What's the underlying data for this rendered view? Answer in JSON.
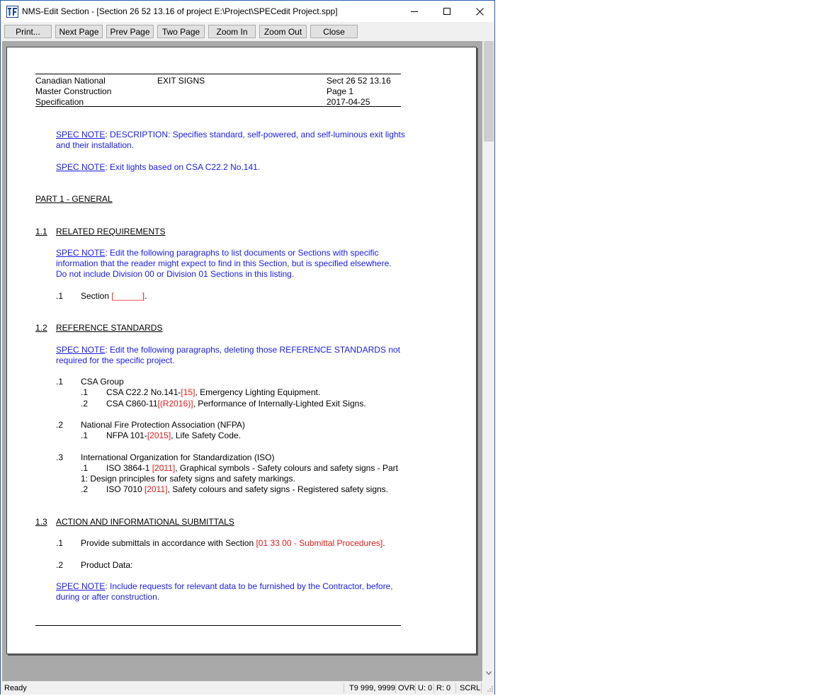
{
  "window": {
    "title": "NMS-Edit Section - [Section 26 52 13.16 of project E:\\Project\\SPECedit Project.spp]",
    "icon": "nms-app-icon",
    "controls": [
      "minimize-icon",
      "maximize-icon",
      "close-icon"
    ]
  },
  "toolbar": {
    "print": "Print...",
    "next_page": "Next Page",
    "prev_page": "Prev Page",
    "two_page": "Two Page",
    "zoom_in": "Zoom In",
    "zoom_out": "Zoom Out",
    "close": "Close"
  },
  "doc": {
    "header": {
      "left1": "Canadian National",
      "left2": "Master Construction",
      "left3": "Specification",
      "center": "EXIT SIGNS",
      "right1": "Sect 26 52 13.16",
      "right2": "Page  1",
      "right3": "2017-04-25"
    },
    "spec_label": "SPEC NOTE",
    "note1_l1": ": DESCRIPTION: Specifies standard, self-powered, and self-luminous exit lights",
    "note1_l2": "and their installation.",
    "note2": ": Exit lights based on CSA C22.2 No.141.",
    "part1": "PART 1 - GENERAL",
    "s11_num": "1.1",
    "s11_title": "RELATED REQUIREMENTS",
    "note3_l1": ": Edit the following paragraphs to list documents or Sections with specific",
    "note3_l2": "information that the reader might expect to find in this Section, but is specified elsewhere.",
    "note3_l3": "Do not include Division 00 or Division 01 Sections in this listing.",
    "item_1": ".1",
    "item_2": ".2",
    "item_3": ".3",
    "section_text": "Section",
    "blank_field": "[______]",
    "period": ".",
    "s12_num": "1.2",
    "s12_title": "REFERENCE STANDARDS",
    "note4_l1": ": Edit the following paragraphs, deleting those REFERENCE STANDARDS not",
    "note4_l2": "required for the specific project.",
    "csa_group": "CSA Group",
    "csa1_a": "CSA C22.2 No.141-",
    "csa1_b": "[15]",
    "csa1_c": ", Emergency Lighting Equipment.",
    "csa2_a": "CSA C860-11",
    "csa2_b": "[(R2016)]",
    "csa2_c": ", Performance of Internally-Lighted Exit Signs.",
    "nfpa": "National Fire Protection Association (NFPA)",
    "nfpa1_a": "NFPA 101-",
    "nfpa1_b": "[2015]",
    "nfpa1_c": ", Life Safety Code.",
    "iso": "International Organization for Standardization (ISO)",
    "iso1_a": "ISO 3864-1 ",
    "iso1_b": "[2011]",
    "iso1_c": ", Graphical symbols - Safety colours and safety signs - Part",
    "iso1_l2": "1: Design principles for safety signs and safety markings.",
    "iso2_a": "ISO 7010 ",
    "iso2_b": "[2011]",
    "iso2_c": ", Safety colours and safety signs - Registered safety signs.",
    "s13_num": "1.3",
    "s13_title": "ACTION AND INFORMATIONAL SUBMITTALS",
    "sub1_a": "Provide submittals in accordance with Section ",
    "sub1_b": "[01 33 00 - Submittal Procedures]",
    "sub1_c": ".",
    "sub2": "Product Data:",
    "note5_l1": ": Include requests for relevant data to be furnished by the Contractor, before,",
    "note5_l2": "during or after construction."
  },
  "status": {
    "ready": "Ready",
    "position": "T9 999, 9999",
    "ovr": "OVR",
    "u": "U: 0",
    "r": "R: 0",
    "scrl": "SCRL"
  },
  "colors": {
    "spec_note": "#1c1ce0",
    "placeholder_bracket": "#e01c1c",
    "window_border": "#2b5fb5"
  }
}
